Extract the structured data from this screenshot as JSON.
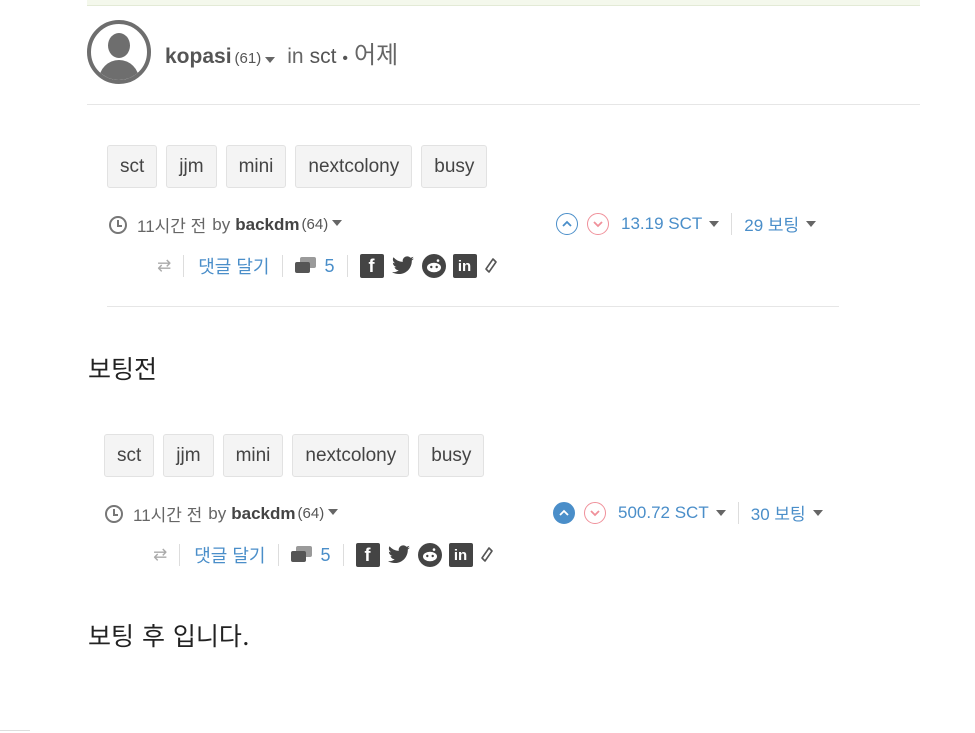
{
  "post_header": {
    "author": "kopasi",
    "reputation": "(61)",
    "in_label": "in",
    "community": "sct",
    "bullet": "•",
    "time_ago": "어제"
  },
  "cards": [
    {
      "tags": [
        "sct",
        "jjm",
        "mini",
        "nextcolony",
        "busy"
      ],
      "time": "11시간 전",
      "by_label": "by",
      "author": "backdm",
      "reputation": "(64)",
      "upvoted": false,
      "payout": "13.19 SCT",
      "votes": "29 보팅",
      "comment_label": "댓글 달기",
      "comment_count": "5"
    },
    {
      "tags": [
        "sct",
        "jjm",
        "mini",
        "nextcolony",
        "busy"
      ],
      "time": "11시간 전",
      "by_label": "by",
      "author": "backdm",
      "reputation": "(64)",
      "upvoted": true,
      "payout": "500.72 SCT",
      "votes": "30 보팅",
      "comment_label": "댓글 달기",
      "comment_count": "5"
    }
  ],
  "captions": {
    "before": "보팅전",
    "after": "보팅 후 입니다."
  },
  "icons": {
    "clock": "clock-icon",
    "upvote": "upvote-icon",
    "downvote": "downvote-icon",
    "reblog": "reblog-icon",
    "comments": "comments-icon",
    "facebook": "facebook-icon",
    "twitter": "twitter-icon",
    "reddit": "reddit-icon",
    "linkedin": "linkedin-icon",
    "link": "link-icon"
  },
  "colors": {
    "accent_blue": "#4a8ec9",
    "downvote_pink": "#f0909a",
    "tag_bg": "#f4f4f4"
  },
  "share_glyphs": {
    "facebook": "f",
    "linkedin": "in"
  }
}
